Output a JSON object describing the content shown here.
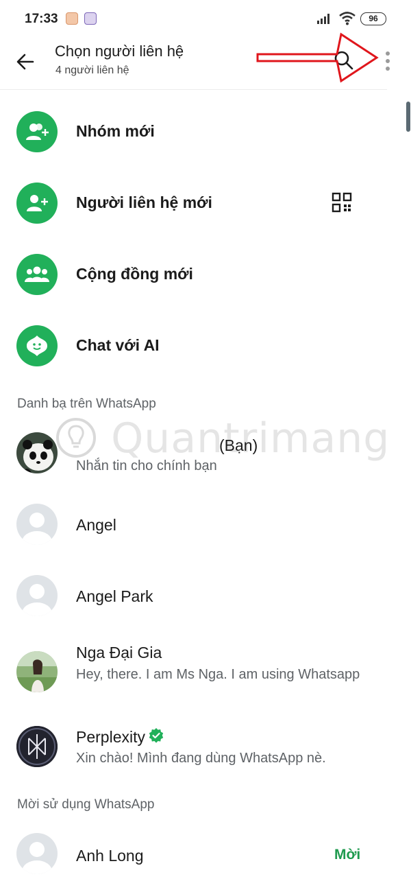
{
  "status_bar": {
    "time": "17:33",
    "battery": "96",
    "notification_icons": [
      "app-notification-icon",
      "viber-icon"
    ]
  },
  "header": {
    "title": "Chọn người liên hệ",
    "subtitle": "4 người liên hệ",
    "icons": [
      "back-arrow-icon",
      "search-icon",
      "more-vert-icon"
    ]
  },
  "actions": [
    {
      "label": "Nhóm mới",
      "icon": "group-add-icon"
    },
    {
      "label": "Người liên hệ mới",
      "icon": "person-add-icon",
      "extra_icon": "qr-code-icon"
    },
    {
      "label": "Cộng đồng mới",
      "icon": "community-icon"
    },
    {
      "label": "Chat với AI",
      "icon": "meta-ai-icon"
    }
  ],
  "sections": {
    "contacts_header": "Danh bạ trên WhatsApp",
    "invite_header": "Mời sử dụng WhatsApp"
  },
  "contacts": [
    {
      "name": "(Bạn)",
      "status": "Nhắn tin cho chính bạn",
      "avatar": "panda-photo"
    },
    {
      "name": "Angel",
      "status": "",
      "avatar": "default-avatar"
    },
    {
      "name": "Angel Park",
      "status": "",
      "avatar": "default-avatar"
    },
    {
      "name": "Nga Đại Gia",
      "status": "Hey, there. I am Ms Nga. I am using Whatsapp",
      "avatar": "outdoor-photo"
    },
    {
      "name": "Perplexity",
      "status": "Xin chào! Mình đang dùng WhatsApp nè.",
      "avatar": "perplexity-logo",
      "verified": true
    }
  ],
  "invite_contacts": [
    {
      "name": "Anh Long",
      "action": "Mời"
    }
  ],
  "watermark": "Quantrimang",
  "colors": {
    "accent_green": "#21b05a",
    "invite_green": "#1e9a4e",
    "annotation_red": "#e0161c"
  }
}
